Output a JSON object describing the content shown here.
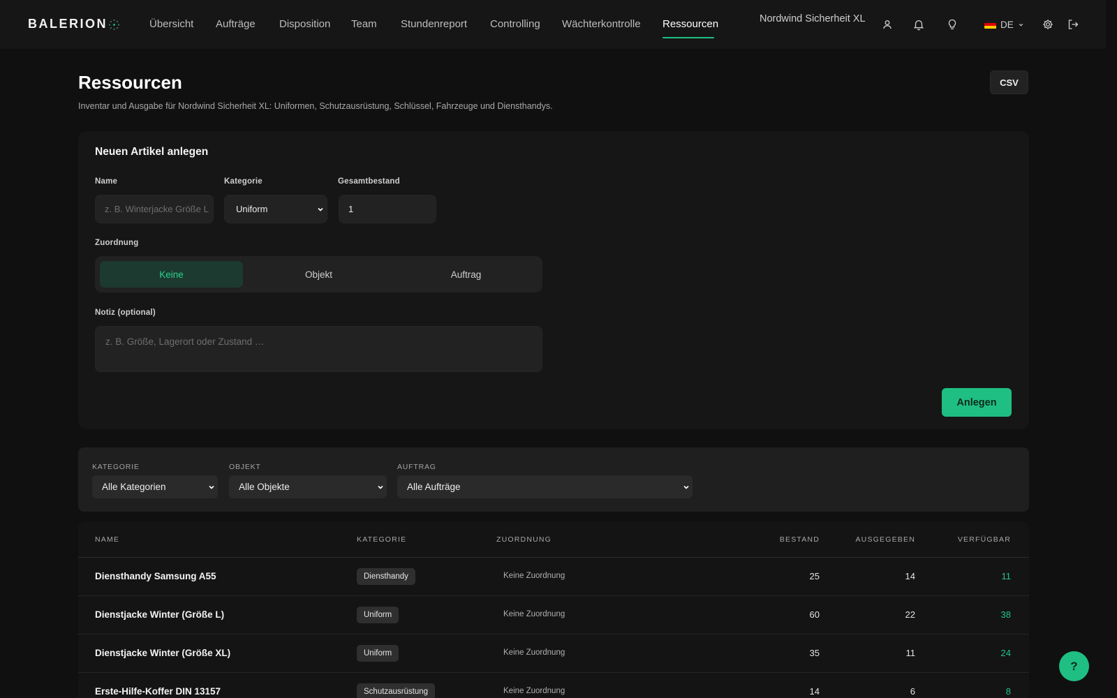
{
  "app": {
    "brand": "BALERION",
    "company": "Nordwind Sicherheit XL",
    "language": "DE",
    "accent_color": "#1fbf83"
  },
  "nav": {
    "items": [
      {
        "label": "Übersicht",
        "active": false
      },
      {
        "label": "Aufträge",
        "active": false
      },
      {
        "label": "Disposition",
        "active": false
      },
      {
        "label": "Team",
        "active": false
      },
      {
        "label": "Stundenreport",
        "active": false
      },
      {
        "label": "Controlling",
        "active": false
      },
      {
        "label": "Wächterkontrolle",
        "active": false
      },
      {
        "label": "Ressourcen",
        "active": true
      }
    ],
    "icons": [
      "user-icon",
      "bell-icon",
      "lightbulb-icon",
      "flag-de-icon",
      "gear-icon",
      "logout-icon"
    ]
  },
  "page": {
    "title": "Ressourcen",
    "subtitle": "Inventar und Ausgabe für Nordwind Sicherheit XL: Uniformen, Schutzausrüstung, Schlüssel, Fahrzeuge und Diensthandys.",
    "csv_label": "CSV"
  },
  "create_form": {
    "title": "Neuen Artikel anlegen",
    "name_label": "Name",
    "name_placeholder": "z. B. Winterjacke Größe L",
    "category_label": "Kategorie",
    "category_value": "Uniform",
    "stock_label": "Gesamtbestand",
    "stock_value": "1",
    "assignment_label": "Zuordnung",
    "assignment_options": [
      "Keine",
      "Objekt",
      "Auftrag"
    ],
    "assignment_selected": "Keine",
    "note_label": "Notiz (optional)",
    "note_placeholder": "z. B. Größe, Lagerort oder Zustand …",
    "submit_label": "Anlegen"
  },
  "filters": {
    "category": {
      "label": "KATEGORIE",
      "value": "Alle Kategorien"
    },
    "object": {
      "label": "OBJEKT",
      "value": "Alle Objekte"
    },
    "order": {
      "label": "AUFTRAG",
      "value": "Alle Aufträge"
    }
  },
  "table": {
    "columns": [
      "NAME",
      "KATEGORIE",
      "ZUORDNUNG",
      "BESTAND",
      "AUSGEGEBEN",
      "VERFÜGBAR"
    ],
    "rows": [
      {
        "name": "Diensthandy Samsung A55",
        "category": "Diensthandy",
        "assignment": "Keine Zuordnung",
        "stock": "25",
        "issued": "14",
        "available": "11"
      },
      {
        "name": "Dienstjacke Winter (Größe L)",
        "category": "Uniform",
        "assignment": "Keine Zuordnung",
        "stock": "60",
        "issued": "22",
        "available": "38"
      },
      {
        "name": "Dienstjacke Winter (Größe XL)",
        "category": "Uniform",
        "assignment": "Keine Zuordnung",
        "stock": "35",
        "issued": "11",
        "available": "24"
      },
      {
        "name": "Erste-Hilfe-Koffer DIN 13157",
        "category": "Schutzausrüstung",
        "assignment": "Keine Zuordnung",
        "stock": "14",
        "issued": "6",
        "available": "8"
      }
    ]
  },
  "help": {
    "label": "?"
  }
}
